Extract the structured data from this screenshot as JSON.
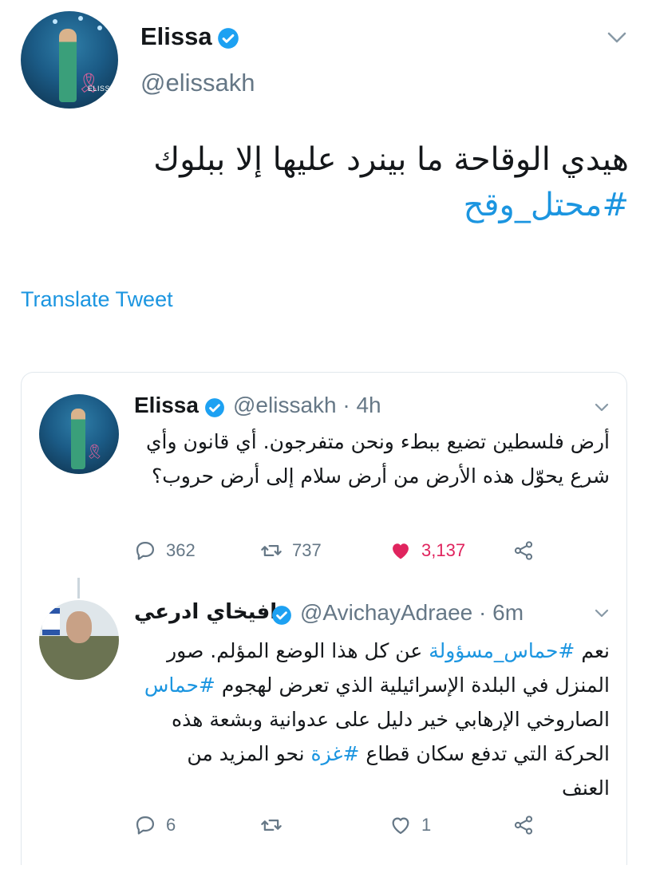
{
  "main_tweet": {
    "name": "Elissa",
    "handle": "@elissakh",
    "avatar_caption": "ELISSA",
    "text": "هيدي الوقاحة ما بينرد عليها إلا ببلوك",
    "hashtag": "#محتل_وقح",
    "translate_label": "Translate Tweet"
  },
  "quoted_tweet_1": {
    "name": "Elissa",
    "handle_time": "@elissakh · 4h",
    "text": "أرض فلسطين تضيع ببطء ونحن متفرجون. أي قانون وأي شرع يحوّل هذه الأرض من أرض سلام إلى أرض حروب؟",
    "replies": "362",
    "retweets": "737",
    "likes": "3,137"
  },
  "quoted_tweet_2": {
    "name": "افيخاي ادرعي",
    "handle_time": "@AvichayAdraee · 6m",
    "text_parts": {
      "p1": "نعم ",
      "tag1": "#حماس_مسؤولة",
      "p2": " عن كل هذا الوضع المؤلم. صور المنزل في البلدة الإسرائيلية الذي تعرض لهجوم ",
      "tag2": "#حماس",
      "p3": " الصاروخي الإرهابي خير دليل على عدوانية وبشعة هذه الحركة التي تدفع سكان قطاع ",
      "tag3": "#غزة",
      "p4": " نحو المزيد من العنف"
    },
    "replies": "6",
    "retweets": "",
    "likes": "1"
  },
  "colors": {
    "link": "#1b95e0",
    "secondary_text": "#657786",
    "like_active": "#e0245e",
    "verified": "#1da1f2",
    "border": "#e1e8ed"
  },
  "icons": [
    "verified-badge-icon",
    "chevron-down-icon",
    "reply-icon",
    "retweet-icon",
    "heart-icon",
    "share-icon"
  ]
}
